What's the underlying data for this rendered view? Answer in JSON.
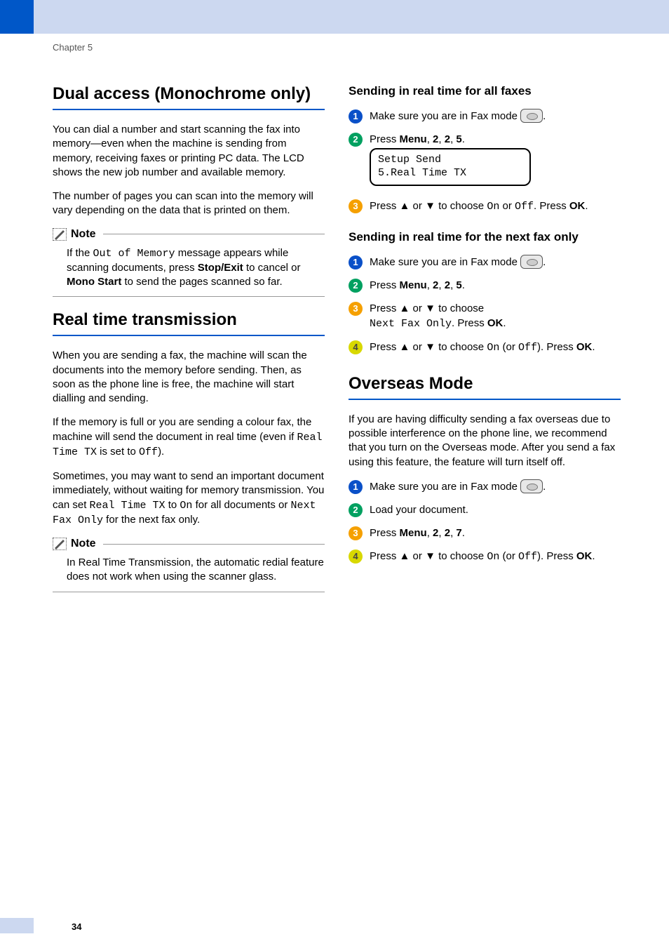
{
  "chapter": "Chapter 5",
  "page_number": "34",
  "left": {
    "dual_access": {
      "title": "Dual access (Monochrome only)",
      "p1": "You can dial a number and start scanning the fax into memory—even when the machine is sending from memory, receiving faxes or printing PC data. The LCD shows the new job number and available memory.",
      "p2": "The number of pages you can scan into the memory will vary depending on the data that is printed on them.",
      "note_label": "Note",
      "note_text_a": "If the ",
      "note_code": "Out of Memory",
      "note_text_b": " message appears while scanning documents, press ",
      "note_bold1": "Stop/Exit",
      "note_text_c": " to cancel or ",
      "note_bold2": "Mono Start",
      "note_text_d": " to send the pages scanned so far."
    },
    "realtime": {
      "title": "Real time transmission",
      "p1": "When you are sending a fax, the machine will scan the documents into the memory before sending. Then, as soon as the phone line is free, the machine will start dialling and sending.",
      "p2a": "If the memory is full or you are sending a colour fax, the machine will send the document in real time (even if ",
      "p2code1": "Real Time TX",
      "p2b": " is set to ",
      "p2code2": "Off",
      "p2c": ").",
      "p3a": "Sometimes, you may want to send an important document immediately, without waiting for memory transmission. You can set ",
      "p3code1": "Real Time TX",
      "p3b": " to ",
      "p3code2": "On",
      "p3c": " for all documents or ",
      "p3code3": "Next Fax Only",
      "p3d": " for the next fax only.",
      "note_label": "Note",
      "note_text": "In Real Time Transmission, the automatic redial feature does not work when using the scanner glass."
    }
  },
  "right": {
    "allfaxes": {
      "title": "Sending in real time for all faxes",
      "step1a": "Make sure you are in Fax mode ",
      "step1b": ".",
      "step2a": "Press ",
      "step2menu": "Menu",
      "step2b": ", ",
      "step2n1": "2",
      "step2n2": "2",
      "step2n3": "5",
      "step2c": ".",
      "lcd_line1": "Setup Send",
      "lcd_line2": "5.Real Time TX",
      "step3a": "Press ",
      "up": "▲",
      "or": " or ",
      "down": "▼",
      "step3b": " to choose ",
      "on": "On",
      "or2": " or ",
      "off": "Off",
      "step3c": ". Press ",
      "ok": "OK",
      "step3d": "."
    },
    "nextfax": {
      "title": "Sending in real time for the next fax only",
      "step1a": "Make sure you are in Fax mode ",
      "step1b": ".",
      "step2a": "Press ",
      "step2menu": "Menu",
      "step2b": ", ",
      "step2n1": "2",
      "step2n2": "2",
      "step2n3": "5",
      "step2c": ".",
      "step3a": "Press ",
      "up": "▲",
      "or": " or ",
      "down": "▼",
      "step3b": " to choose ",
      "code": "Next Fax Only",
      "step3c": ". Press ",
      "ok": "OK",
      "step3d": ".",
      "step4a": "Press ",
      "step4b": " to choose ",
      "on": "On",
      "paren_or": " (or ",
      "off": "Off",
      "paren_close": "). Press ",
      "ok2": "OK",
      "step4c": "."
    },
    "overseas": {
      "title": "Overseas Mode",
      "p1": "If you are having difficulty sending a fax overseas due to possible interference on the phone line, we recommend that you turn on the Overseas mode. After you send a fax using this feature, the feature will turn itself off.",
      "step1a": "Make sure you are in Fax mode ",
      "step1b": ".",
      "step2": "Load your document.",
      "step3a": "Press ",
      "step3menu": "Menu",
      "step3b": ", ",
      "step3n1": "2",
      "step3n2": "2",
      "step3n3": "7",
      "step3c": ".",
      "step4a": "Press ",
      "up": "▲",
      "or": " or ",
      "down": "▼",
      "step4b": " to choose ",
      "on": "On",
      "paren_or": " (or ",
      "off": "Off",
      "paren_close": "). Press ",
      "ok": "OK",
      "step4c": "."
    }
  }
}
